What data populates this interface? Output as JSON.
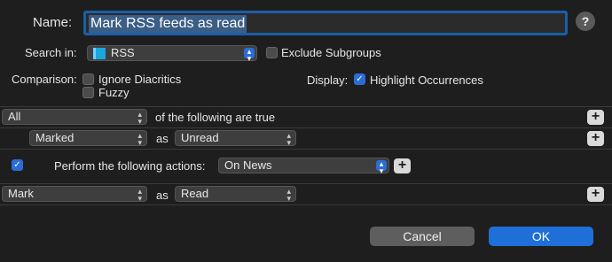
{
  "name": {
    "label": "Name:",
    "value": "Mark RSS feeds as read"
  },
  "help": {
    "label": "?"
  },
  "search_in": {
    "label": "Search in:",
    "value": "RSS",
    "icon": "rss-group-icon",
    "accent": "#1ba6e0"
  },
  "exclude_subgroups": {
    "label": "Exclude Subgroups",
    "checked": false
  },
  "comparison": {
    "label": "Comparison:",
    "ignore_diacritics": "Ignore Diacritics",
    "fuzzy": "Fuzzy"
  },
  "display": {
    "label": "Display:",
    "highlight": "Highlight Occurrences",
    "checked": true
  },
  "condition_header": {
    "quantifier": "All",
    "text": "of the following are true"
  },
  "condition_row": {
    "field": "Marked",
    "as": "as",
    "value": "Unread"
  },
  "actions": {
    "enabled": true,
    "label": "Perform the following actions:",
    "trigger": "On News"
  },
  "action_row": {
    "action": "Mark",
    "as": "as",
    "value": "Read"
  },
  "buttons": {
    "cancel": "Cancel",
    "ok": "OK"
  },
  "colors": {
    "accent": "#1f6fd9",
    "background": "#1e1e1e"
  }
}
